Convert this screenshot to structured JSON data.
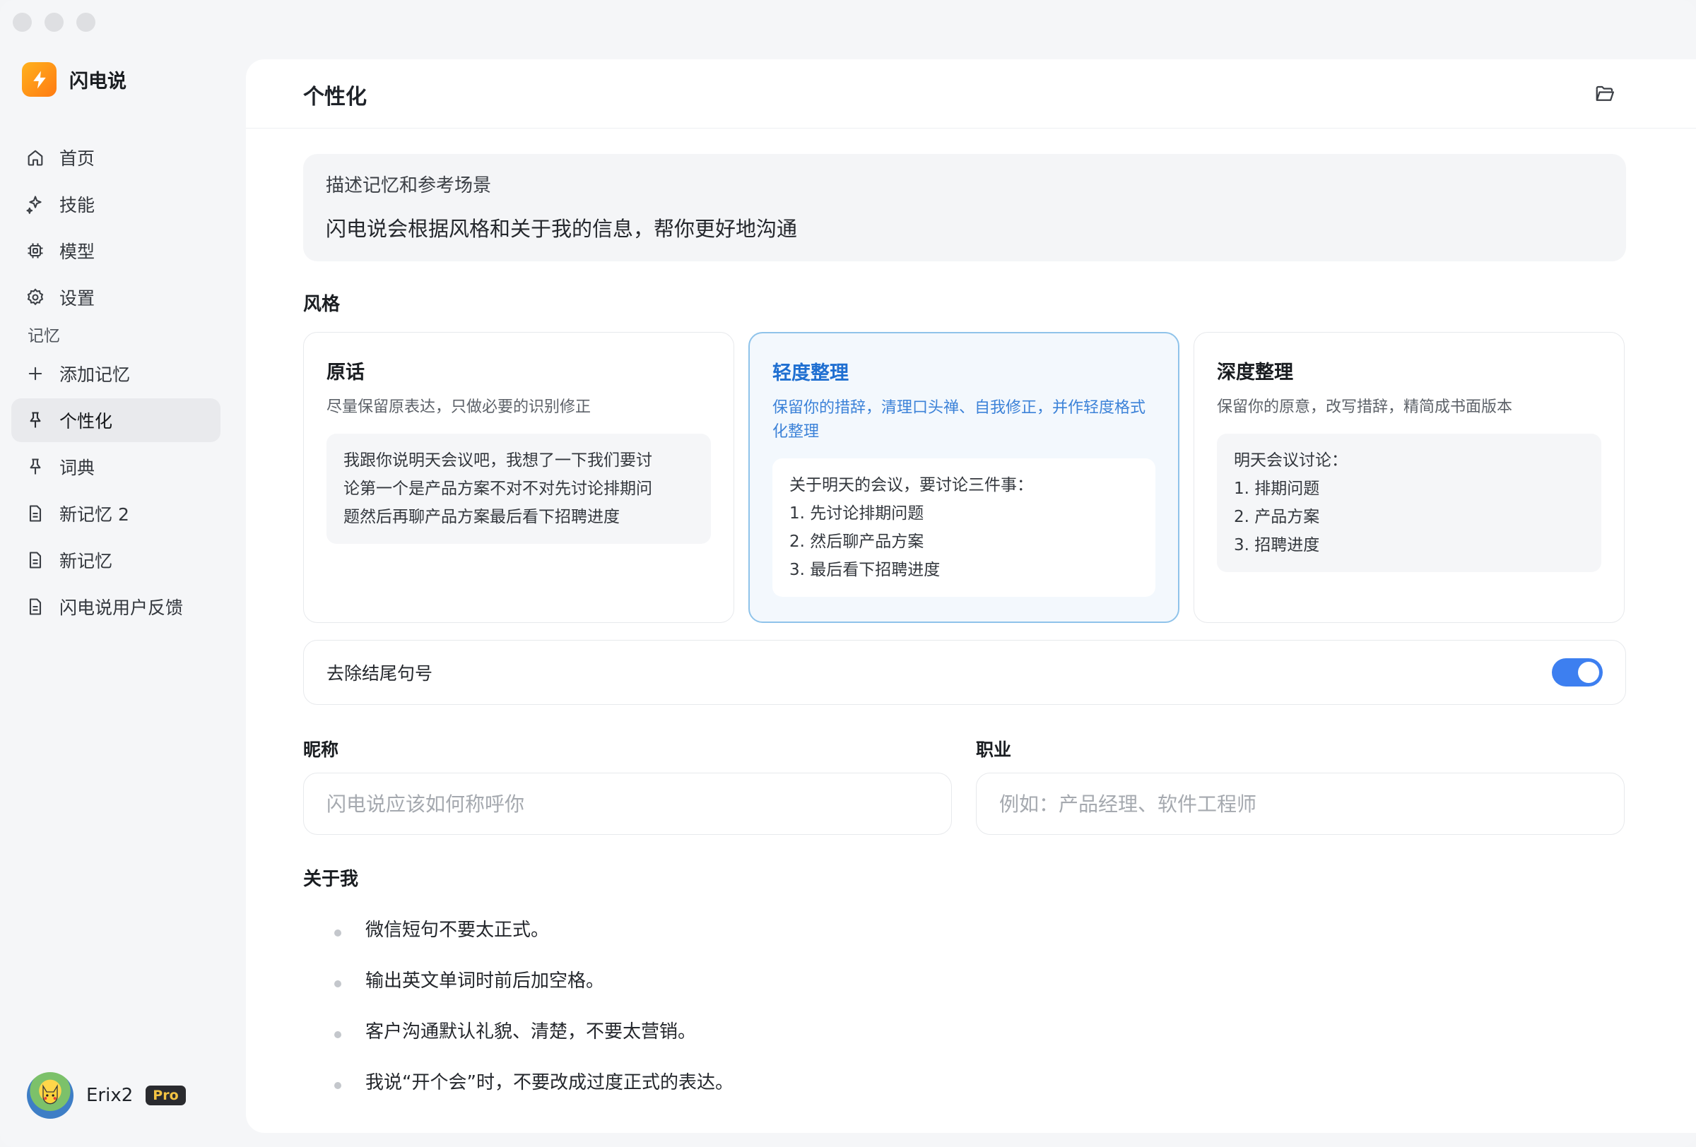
{
  "app": {
    "name": "闪电说"
  },
  "sidebar": {
    "nav": [
      {
        "label": "首页",
        "icon": "home-icon"
      },
      {
        "label": "技能",
        "icon": "sparkle-icon"
      },
      {
        "label": "模型",
        "icon": "chip-icon"
      },
      {
        "label": "设置",
        "icon": "gear-icon"
      }
    ],
    "memory_section_label": "记忆",
    "memory_items": [
      {
        "label": "添加记忆",
        "icon": "plus-icon"
      },
      {
        "label": "个性化",
        "icon": "pin-icon",
        "active": true
      },
      {
        "label": "词典",
        "icon": "pin-icon"
      },
      {
        "label": "新记忆 2",
        "icon": "document-icon"
      },
      {
        "label": "新记忆",
        "icon": "document-icon"
      },
      {
        "label": "闪电说用户反馈",
        "icon": "document-icon"
      }
    ],
    "user": {
      "name": "Erix2",
      "badge": "Pro"
    }
  },
  "main": {
    "title": "个性化",
    "description": {
      "title": "描述记忆和参考场景",
      "text": "闪电说会根据风格和关于我的信息，帮你更好地沟通"
    },
    "style_section_title": "风格",
    "styles": [
      {
        "name": "原话",
        "desc": "尽量保留原表达，只做必要的识别修正",
        "sample": [
          "我跟你说明天会议吧，我想了一下我们要讨",
          "论第一个是产品方案不对不对先讨论排期问",
          "题然后再聊产品方案最后看下招聘进度"
        ],
        "selected": false
      },
      {
        "name": "轻度整理",
        "desc": "保留你的措辞，清理口头禅、自我修正，并作轻度格式化整理",
        "sample": [
          "关于明天的会议，要讨论三件事：",
          "1. 先讨论排期问题",
          "2. 然后聊产品方案",
          "3. 最后看下招聘进度"
        ],
        "selected": true
      },
      {
        "name": "深度整理",
        "desc": "保留你的原意，改写措辞，精简成书面版本",
        "sample": [
          "明天会议讨论：",
          "1. 排期问题",
          "2. 产品方案",
          "3. 招聘进度"
        ],
        "selected": false
      }
    ],
    "remove_period": {
      "label": "去除结尾句号",
      "enabled": true
    },
    "nickname": {
      "label": "昵称",
      "value": "",
      "placeholder": "闪电说应该如何称呼你"
    },
    "occupation": {
      "label": "职业",
      "value": "",
      "placeholder": "例如：产品经理、软件工程师"
    },
    "about_title": "关于我",
    "about_items": [
      "微信短句不要太正式。",
      "输出英文单词时前后加空格。",
      "客户沟通默认礼貌、清楚，不要太营销。",
      "我说“开个会”时，不要改成过度正式的表达。"
    ]
  },
  "colors": {
    "accent": "#3d7ff0",
    "selected_text": "#1f6fd1",
    "selected_border": "#8fc3ea",
    "brand": "#ff9a1a"
  }
}
